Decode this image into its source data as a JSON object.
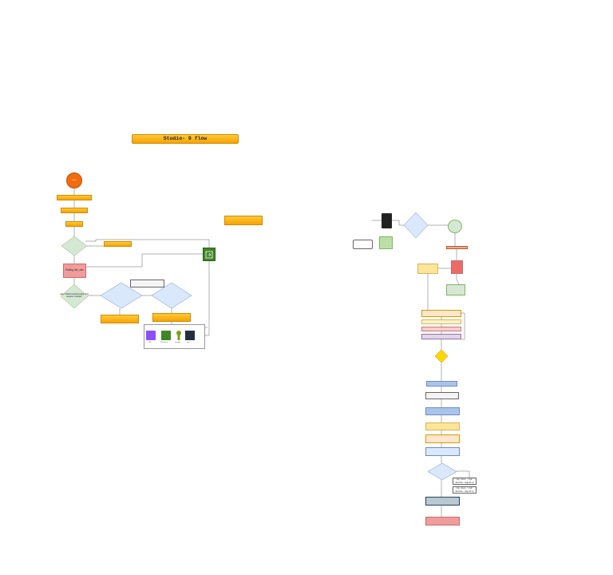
{
  "title": "Studio- 9 flow",
  "start_label": "Start",
  "rolling_label": "Rolling mic_ues",
  "step2_label": "step 2 Build transformation fine session module?",
  "icons": {
    "vpc": "VPC",
    "s3": "S3_bucket",
    "lambda": "Lambda",
    "chip": "chip"
  },
  "terminal_cmd1": "rnp docs_'cnd' delete registry",
  "terminal_cmd2": "rnp docs_'cnd' delete registry"
}
